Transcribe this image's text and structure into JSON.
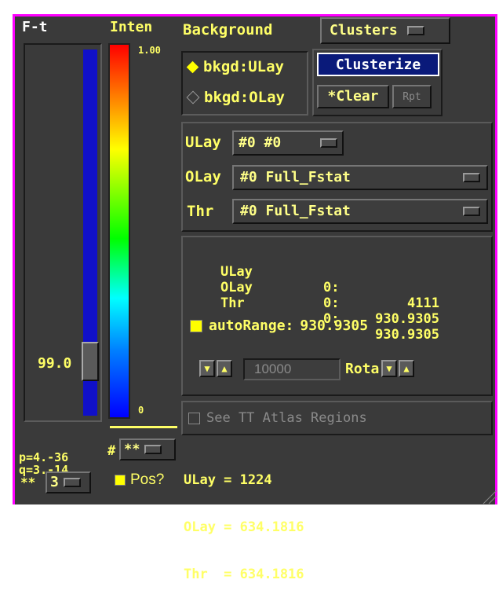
{
  "colors": {
    "accent": "#ffff66",
    "frame": "#ff00ff",
    "panel": "#3a3a3a",
    "blue_bar": "#1010c8",
    "clusterize_bg": "#0a1a7a"
  },
  "ft_column": {
    "title": "F-t",
    "slider_value": "99.0",
    "slider_fraction": 0.22,
    "p_line": "p=4.-36",
    "q_line": "q=3.-14",
    "decim_prefix": "**",
    "decim_value": "3"
  },
  "inten_column": {
    "title": "Inten",
    "top_label": "1.00",
    "bottom_label": "0"
  },
  "background": {
    "title": "Background",
    "options": [
      {
        "label": "bkgd:ULay",
        "selected": true
      },
      {
        "label": "bkgd:OLay",
        "selected": false
      }
    ]
  },
  "clusters": {
    "menu_label": "Clusters",
    "clusterize_label": "Clusterize",
    "clear_label": "*Clear",
    "rpt_label": "Rpt"
  },
  "datasets": {
    "ulay": {
      "label": "ULay",
      "value": "#0 #0"
    },
    "olay": {
      "label": "OLay",
      "value": "#0 Full_Fstat"
    },
    "thr": {
      "label": "Thr",
      "value": "#0 Full_Fstat"
    }
  },
  "info": {
    "rows": [
      {
        "name": "ULay",
        "index": "0:",
        "value": "4111"
      },
      {
        "name": "OLay",
        "index": "0:",
        "value": "930.9305"
      },
      {
        "name": "Thr",
        "index": "0:",
        "value": "930.9305"
      }
    ],
    "autorange_label": "autoRange:",
    "autorange_value": "930.9305",
    "range_value": "10000",
    "rota_label": "Rota"
  },
  "atlas": {
    "label": "See TT Atlas Regions"
  },
  "bottom": {
    "stars_prefix": "#",
    "stars_value": "**",
    "pos_label": "Pos?",
    "ulay_line": "ULay = 1224",
    "olay_line": "OLay = 634.1816",
    "thr_line": "Thr  = 634.1816"
  }
}
